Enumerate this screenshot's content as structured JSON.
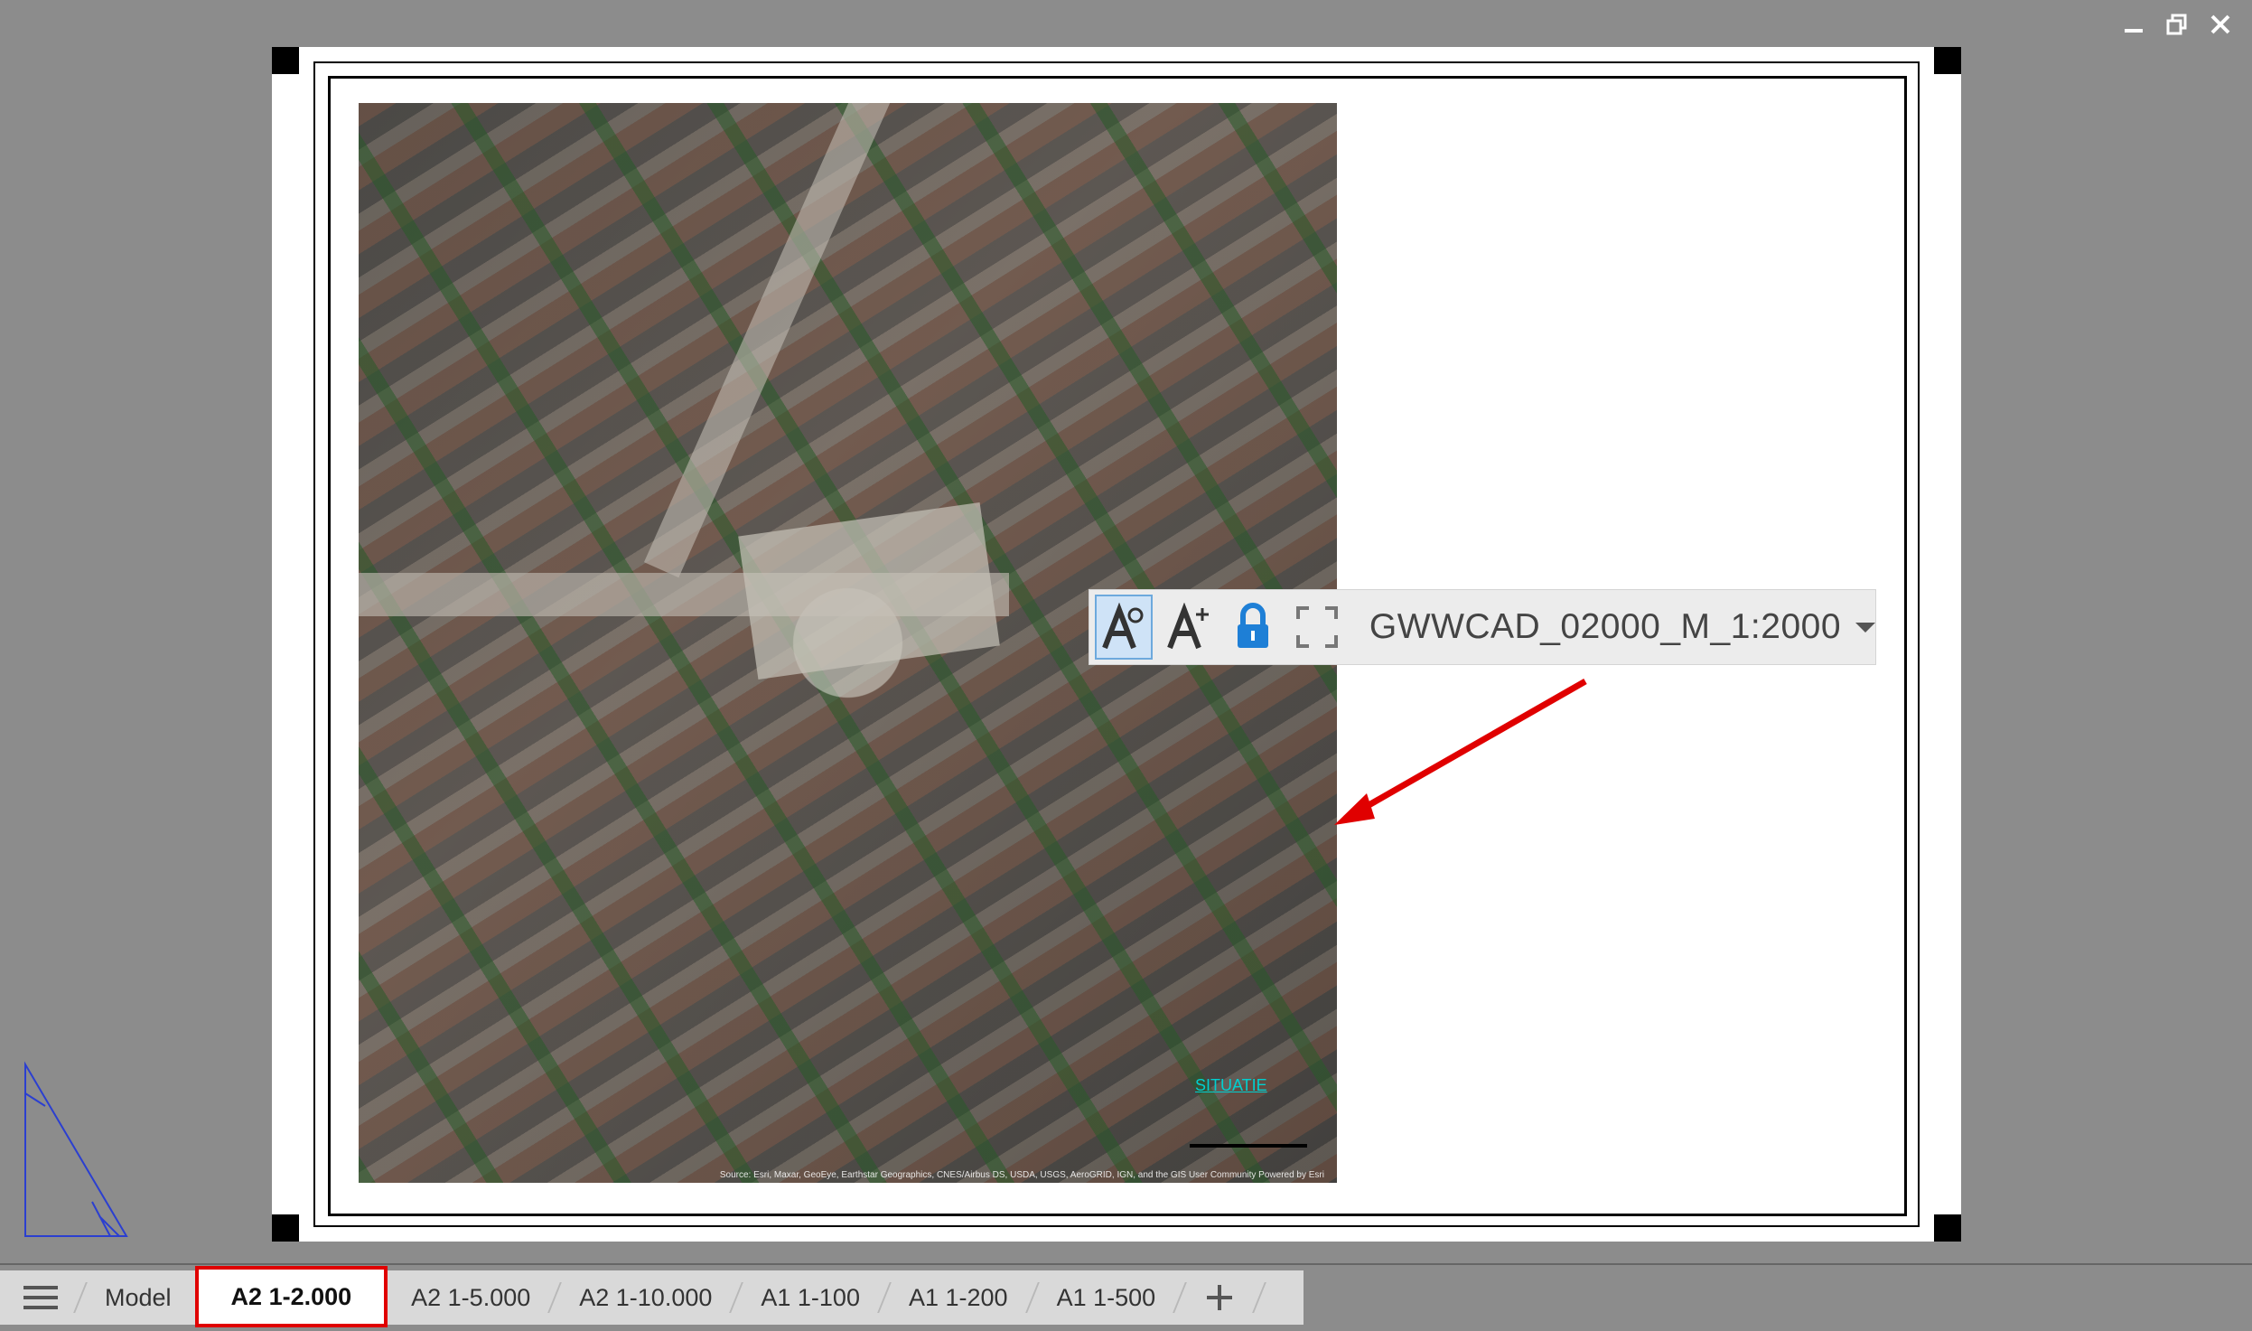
{
  "window": {
    "minimize_icon": "minimize-icon",
    "restore_icon": "restore-icon",
    "close_icon": "close-icon"
  },
  "viewport": {
    "map_label": "SITUATIE",
    "map_credit": "Source: Esri, Maxar, GeoEye, Earthstar Geographics, CNES/Airbus DS, USDA, USGS, AeroGRID, IGN, and the GIS User Community Powered by Esri"
  },
  "viewport_toolbar": {
    "buttons": [
      {
        "icon": "annotation-scale-icon",
        "active": true
      },
      {
        "icon": "auto-scale-icon",
        "active": false
      },
      {
        "icon": "lock-icon",
        "active": false
      },
      {
        "icon": "maximize-viewport-icon",
        "active": false
      }
    ],
    "scale_value": "GWWCAD_02000_M_1:2000"
  },
  "colors": {
    "accent": "#1e7fd6",
    "highlight": "#e00000",
    "map_label": "#00d0d0"
  },
  "tabs": {
    "menu_icon": "hamburger-menu-icon",
    "items": [
      "Model",
      "A2 1-2.000",
      "A2 1-5.000",
      "A2 1-10.000",
      "A1 1-100",
      "A1 1-200",
      "A1 1-500"
    ],
    "active": "A2 1-2.000",
    "add_icon": "plus-icon"
  }
}
